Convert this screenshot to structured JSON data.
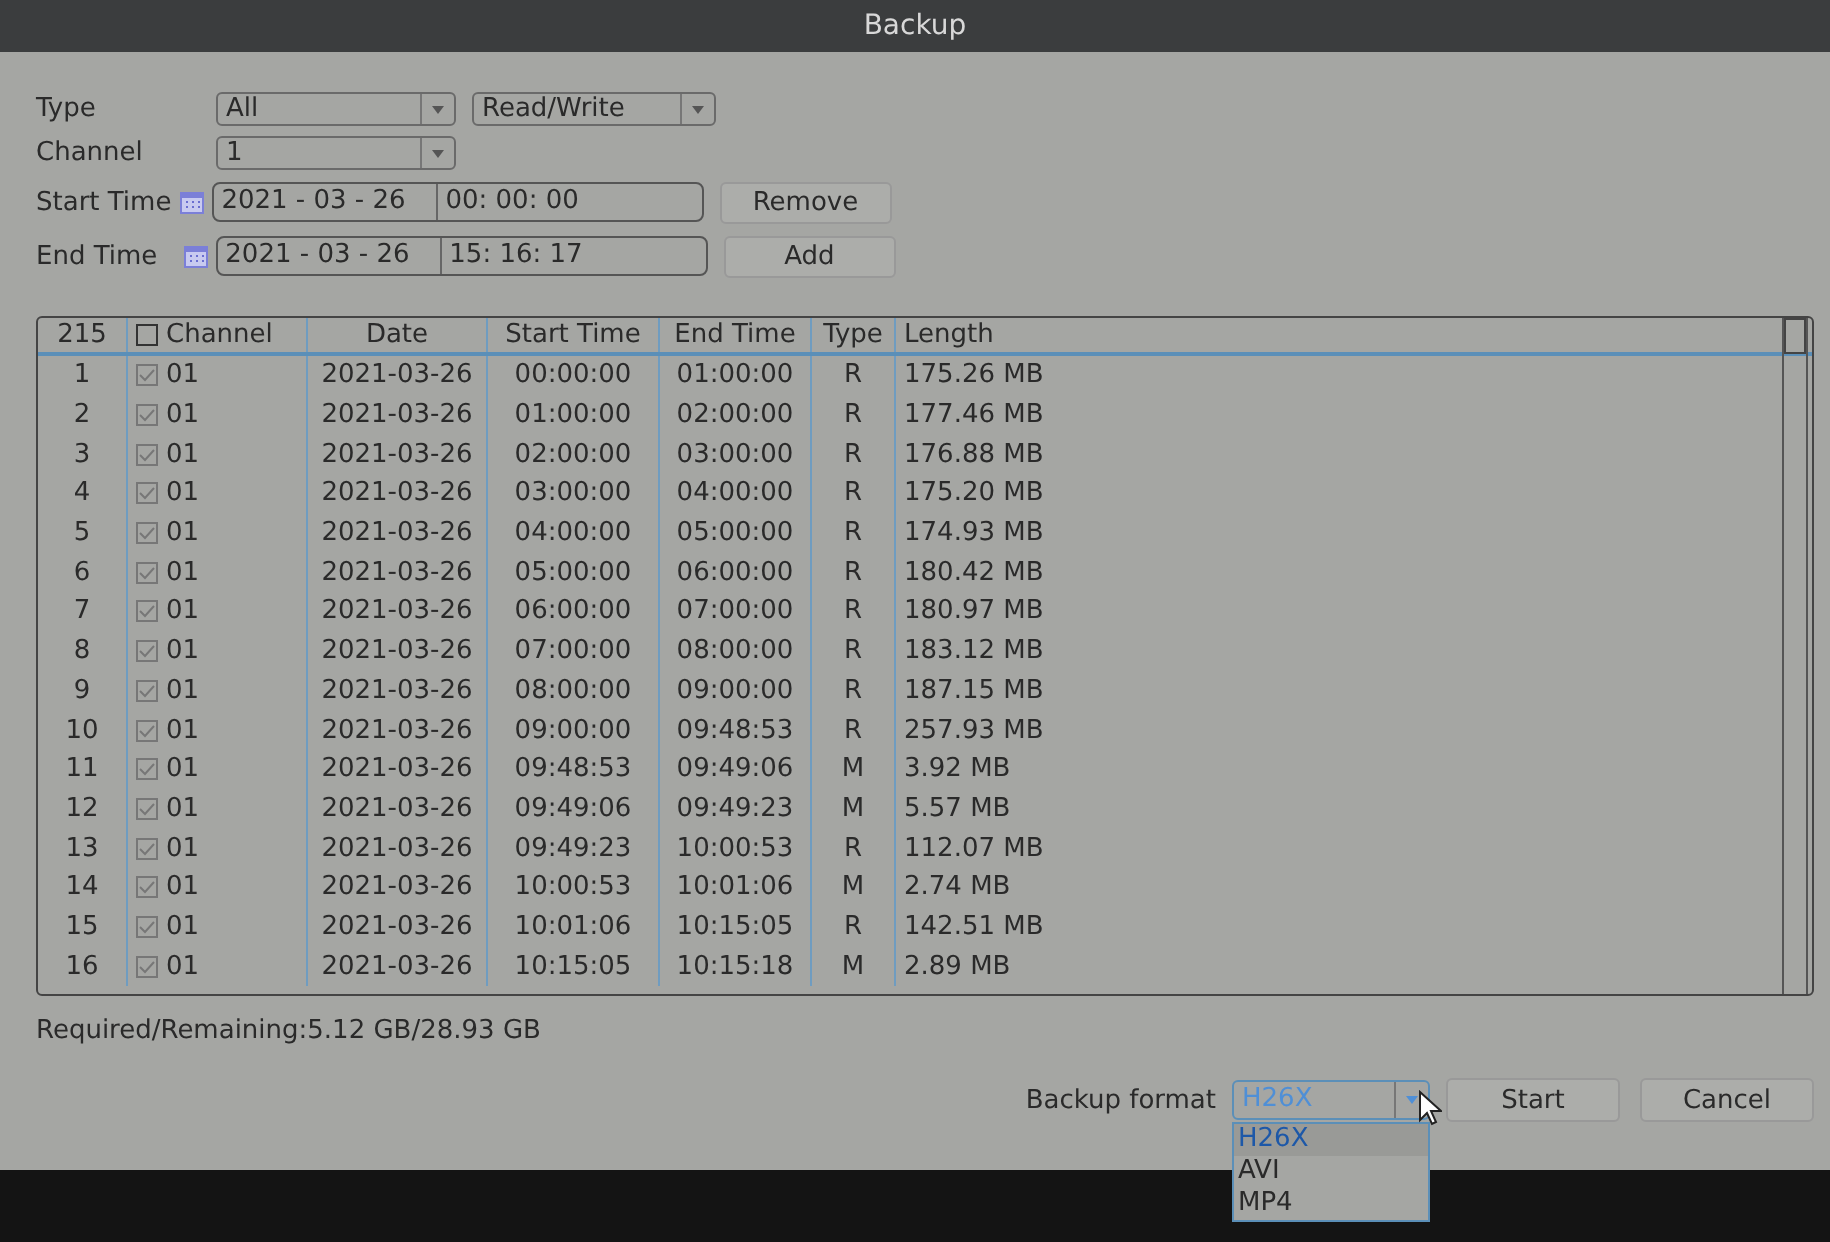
{
  "window": {
    "title": "Backup"
  },
  "filters": {
    "type_label": "Type",
    "type_value": "All",
    "mode_value": "Read/Write",
    "channel_label": "Channel",
    "channel_value": "1",
    "start_label": "Start Time",
    "start_date": "2021 - 03 - 26",
    "start_time": "00: 00: 00",
    "end_label": "End Time",
    "end_date": "2021 - 03 - 26",
    "end_time": "15: 16: 17",
    "buttons": [
      "Remove",
      "Add"
    ]
  },
  "table": {
    "count": "215",
    "all_checked": false,
    "columns": [
      "Channel",
      "Date",
      "Start Time",
      "End Time",
      "Type",
      "Length"
    ],
    "rows": [
      {
        "index": "1",
        "checked": true,
        "channel": "01",
        "date": "2021-03-26",
        "start": "00:00:00",
        "end": "01:00:00",
        "type": "R",
        "length": "175.26 MB"
      },
      {
        "index": "2",
        "checked": true,
        "channel": "01",
        "date": "2021-03-26",
        "start": "01:00:00",
        "end": "02:00:00",
        "type": "R",
        "length": "177.46 MB"
      },
      {
        "index": "3",
        "checked": true,
        "channel": "01",
        "date": "2021-03-26",
        "start": "02:00:00",
        "end": "03:00:00",
        "type": "R",
        "length": "176.88 MB"
      },
      {
        "index": "4",
        "checked": true,
        "channel": "01",
        "date": "2021-03-26",
        "start": "03:00:00",
        "end": "04:00:00",
        "type": "R",
        "length": "175.20 MB"
      },
      {
        "index": "5",
        "checked": true,
        "channel": "01",
        "date": "2021-03-26",
        "start": "04:00:00",
        "end": "05:00:00",
        "type": "R",
        "length": "174.93 MB"
      },
      {
        "index": "6",
        "checked": true,
        "channel": "01",
        "date": "2021-03-26",
        "start": "05:00:00",
        "end": "06:00:00",
        "type": "R",
        "length": "180.42 MB"
      },
      {
        "index": "7",
        "checked": true,
        "channel": "01",
        "date": "2021-03-26",
        "start": "06:00:00",
        "end": "07:00:00",
        "type": "R",
        "length": "180.97 MB"
      },
      {
        "index": "8",
        "checked": true,
        "channel": "01",
        "date": "2021-03-26",
        "start": "07:00:00",
        "end": "08:00:00",
        "type": "R",
        "length": "183.12 MB"
      },
      {
        "index": "9",
        "checked": true,
        "channel": "01",
        "date": "2021-03-26",
        "start": "08:00:00",
        "end": "09:00:00",
        "type": "R",
        "length": "187.15 MB"
      },
      {
        "index": "10",
        "checked": true,
        "channel": "01",
        "date": "2021-03-26",
        "start": "09:00:00",
        "end": "09:48:53",
        "type": "R",
        "length": "257.93 MB"
      },
      {
        "index": "11",
        "checked": true,
        "channel": "01",
        "date": "2021-03-26",
        "start": "09:48:53",
        "end": "09:49:06",
        "type": "M",
        "length": "3.92 MB"
      },
      {
        "index": "12",
        "checked": true,
        "channel": "01",
        "date": "2021-03-26",
        "start": "09:49:06",
        "end": "09:49:23",
        "type": "M",
        "length": "5.57 MB"
      },
      {
        "index": "13",
        "checked": true,
        "channel": "01",
        "date": "2021-03-26",
        "start": "09:49:23",
        "end": "10:00:53",
        "type": "R",
        "length": "112.07 MB"
      },
      {
        "index": "14",
        "checked": true,
        "channel": "01",
        "date": "2021-03-26",
        "start": "10:00:53",
        "end": "10:01:06",
        "type": "M",
        "length": "2.74 MB"
      },
      {
        "index": "15",
        "checked": true,
        "channel": "01",
        "date": "2021-03-26",
        "start": "10:01:06",
        "end": "10:15:05",
        "type": "R",
        "length": "142.51 MB"
      },
      {
        "index": "16",
        "checked": true,
        "channel": "01",
        "date": "2021-03-26",
        "start": "10:15:05",
        "end": "10:15:18",
        "type": "M",
        "length": "2.89 MB"
      }
    ]
  },
  "summary": "Required/Remaining:5.12 GB/28.93 GB",
  "backup_format": {
    "label": "Backup format",
    "value": "H26X",
    "options": [
      {
        "label": "H26X",
        "selected": true
      },
      {
        "label": "AVI",
        "selected": false
      },
      {
        "label": "MP4",
        "selected": false
      }
    ]
  },
  "buttons": [
    "Start",
    "Cancel"
  ]
}
